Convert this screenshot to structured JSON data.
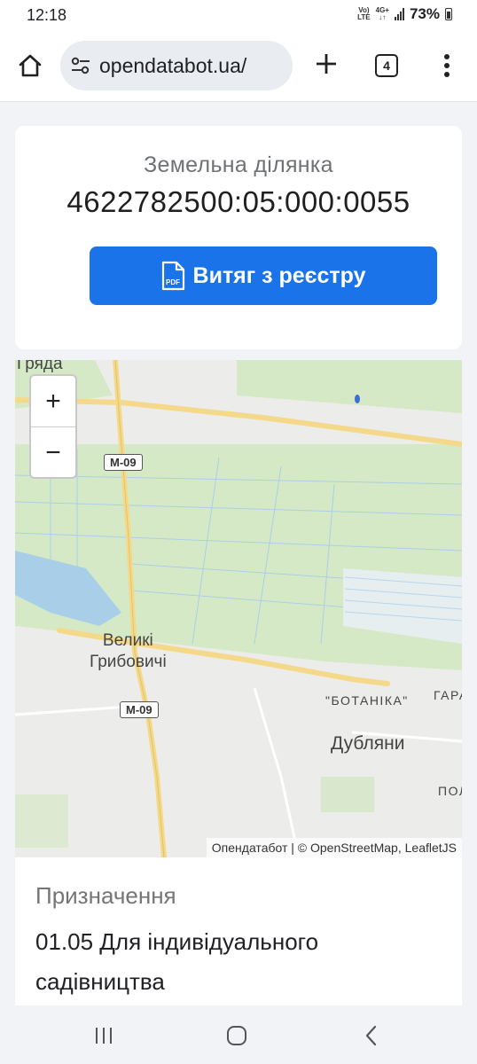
{
  "status_bar": {
    "time": "12:18",
    "net_top": "Vo)",
    "net_bottom": "LTE",
    "net_type_top": "4G+",
    "net_type_bottom": "↓↑",
    "battery": "73%"
  },
  "browser": {
    "url": "opendatabot.ua/",
    "tab_count": "4"
  },
  "card": {
    "subtitle": "Земельна ділянка",
    "cadastral_number": "4622782500:05:000:0055",
    "extract_button": "Витяг з реєстру",
    "pdf_icon_text": "PDF"
  },
  "map": {
    "zoom_in": "+",
    "zoom_out": "−",
    "labels": {
      "place_top": "Гряда",
      "village_line1": "Великі",
      "village_line2": "Грибовичі",
      "botanika": "\"БОТАНІКА\"",
      "town": "Дубляни",
      "edge_top": "ГАРА",
      "edge_bottom": "ПОЛ"
    },
    "road_shields": [
      "М-09",
      "М-09"
    ],
    "attribution": "Опендатабот | © OpenStreetMap, LeafletJS"
  },
  "info": {
    "label": "Призначення",
    "value": "01.05 Для індивідуального садівництва"
  }
}
